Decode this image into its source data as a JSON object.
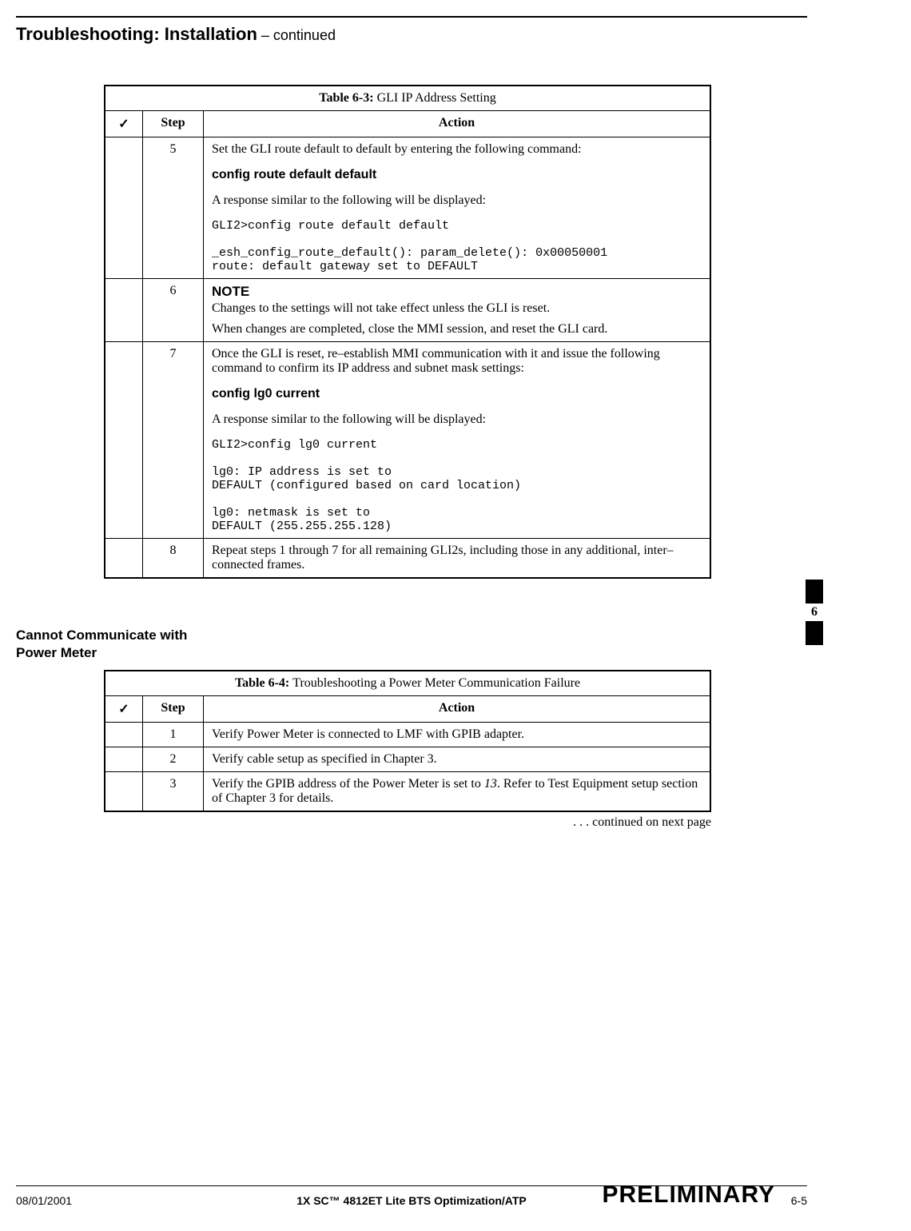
{
  "header": {
    "title_main": "Troubleshooting: Installation",
    "title_cont": " – continued"
  },
  "table63": {
    "title_prefix": "Table 6-3: ",
    "title_rest": "GLI IP Address Setting",
    "col_check": "✓",
    "col_step": "Step",
    "col_action": "Action",
    "rows": [
      {
        "step": "5",
        "p1": "Set the GLI route default to default by entering the following command:",
        "cmd": "config route default default",
        "p2": "A response similar to the following will be displayed:",
        "out": "GLI2>config route default default\n\n_esh_config_route_default(): param_delete(): 0x00050001\nroute: default gateway set to DEFAULT"
      },
      {
        "step": "6",
        "note_label": "NOTE",
        "p1": "Changes to the settings will not take effect unless the GLI is reset.",
        "p2": "When changes are completed, close the MMI session, and reset the GLI card."
      },
      {
        "step": "7",
        "p1": "Once the GLI is reset, re–establish MMI communication with it and issue the following command to confirm its IP address and subnet mask settings:",
        "cmd": "config lg0 current",
        "p2": "A response similar to the following will be displayed:",
        "out": "GLI2>config lg0 current\n\nlg0: IP address is set to\nDEFAULT (configured based on card location)\n\nlg0: netmask is set to\nDEFAULT (255.255.255.128)"
      },
      {
        "step": "8",
        "p1": "Repeat steps 1 through 7 for all remaining GLI2s, including those in any additional, inter–connected frames."
      }
    ]
  },
  "section2_heading_l1": "Cannot Communicate with",
  "section2_heading_l2": "Power Meter",
  "table64": {
    "title_prefix": "Table 6-4: ",
    "title_rest": "Troubleshooting a Power Meter Communication Failure",
    "col_check": "✓",
    "col_step": "Step",
    "col_action": "Action",
    "rows": [
      {
        "step": "1",
        "action": "Verify Power Meter is connected to LMF with GPIB adapter."
      },
      {
        "step": "2",
        "action": "Verify cable setup as specified in Chapter 3."
      },
      {
        "step": "3",
        "action_pre": "Verify the GPIB address of the Power Meter is set to ",
        "action_em": "13",
        "action_post": ". Refer to Test Equipment setup section of Chapter 3 for details."
      }
    ]
  },
  "continued_text": ". . . continued on next page",
  "side_tab_num": "6",
  "footer": {
    "date": "08/01/2001",
    "center": "1X SC™ 4812ET Lite BTS Optimization/ATP",
    "prelim": "PRELIMINARY",
    "pagenum": "6-5"
  }
}
